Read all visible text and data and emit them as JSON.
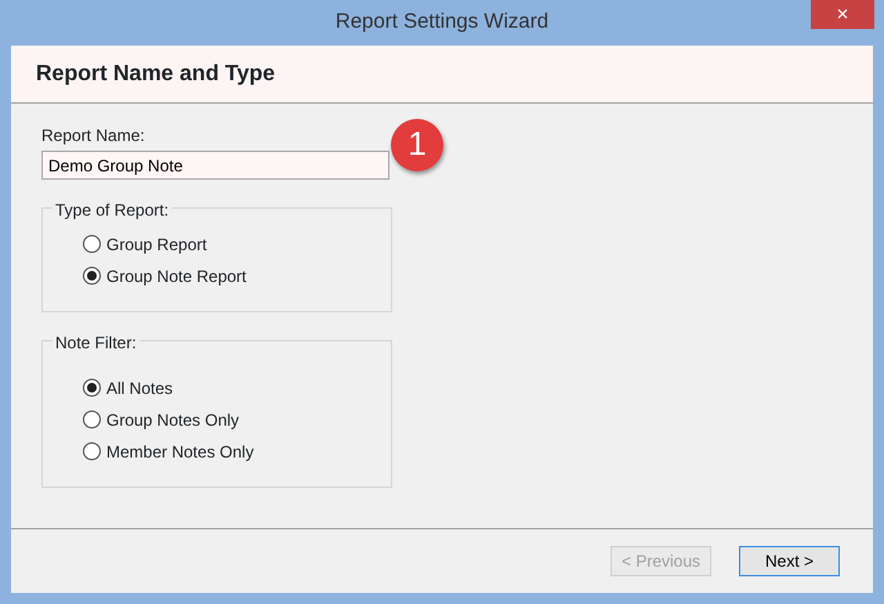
{
  "window": {
    "title": "Report Settings Wizard",
    "close": "×"
  },
  "header": {
    "title": "Report Name and Type"
  },
  "report_name": {
    "label": "Report Name:",
    "value": "Demo Group Note"
  },
  "callout": {
    "number": "1"
  },
  "groups": [
    {
      "legend": "Type of Report:",
      "options": [
        {
          "label": "Group Report",
          "selected": false
        },
        {
          "label": "Group Note Report",
          "selected": true
        }
      ]
    },
    {
      "legend": "Note Filter:",
      "options": [
        {
          "label": "All Notes",
          "selected": true
        },
        {
          "label": "Group Notes Only",
          "selected": false
        },
        {
          "label": "Member Notes Only",
          "selected": false
        }
      ]
    }
  ],
  "buttons": [
    {
      "label": "< Previous",
      "disabled": true,
      "focused": false
    },
    {
      "label": "Next >",
      "disabled": false,
      "focused": true
    }
  ]
}
